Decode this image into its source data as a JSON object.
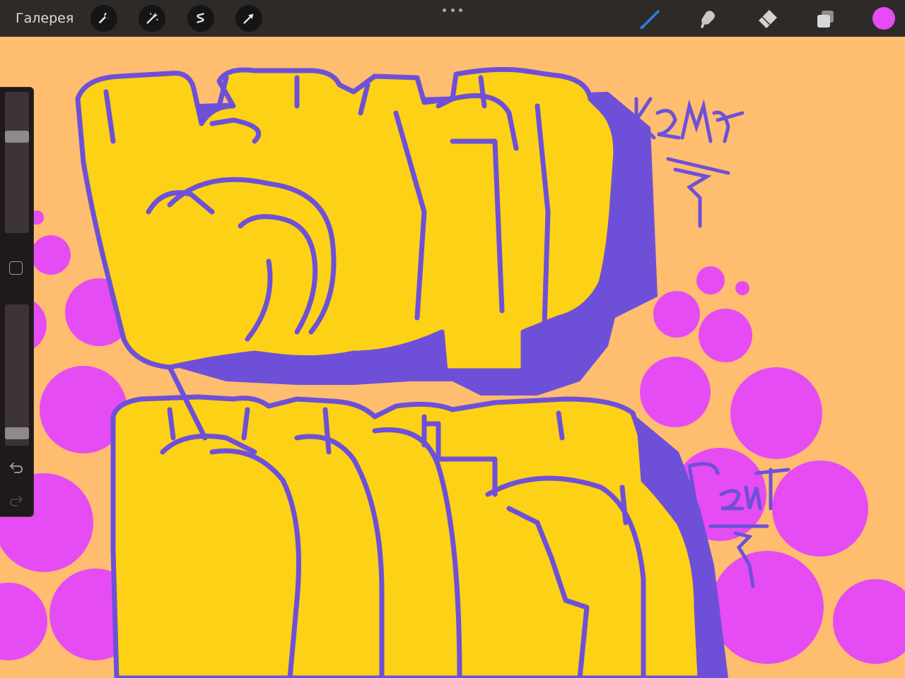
{
  "toolbar": {
    "gallery_label": "Галерея",
    "left_tools": [
      "wrench-icon",
      "magic-wand-icon",
      "selection-icon",
      "move-arrow-icon"
    ],
    "right_tools": [
      "brush-icon",
      "smudge-icon",
      "eraser-icon",
      "layers-icon"
    ],
    "active_tool": "brush-icon",
    "current_color": "#e54cf3"
  },
  "canvas": {
    "background_color": "#ffbd70",
    "tag_top": "кема",
    "tag_bottom": "пеит",
    "fill_color": "#fdd116",
    "outline_color": "#6e50d8",
    "bubble_color": "#e54cf3"
  },
  "sidebar": {
    "brush_size_level": 0.7,
    "opacity_level": 0.05
  }
}
